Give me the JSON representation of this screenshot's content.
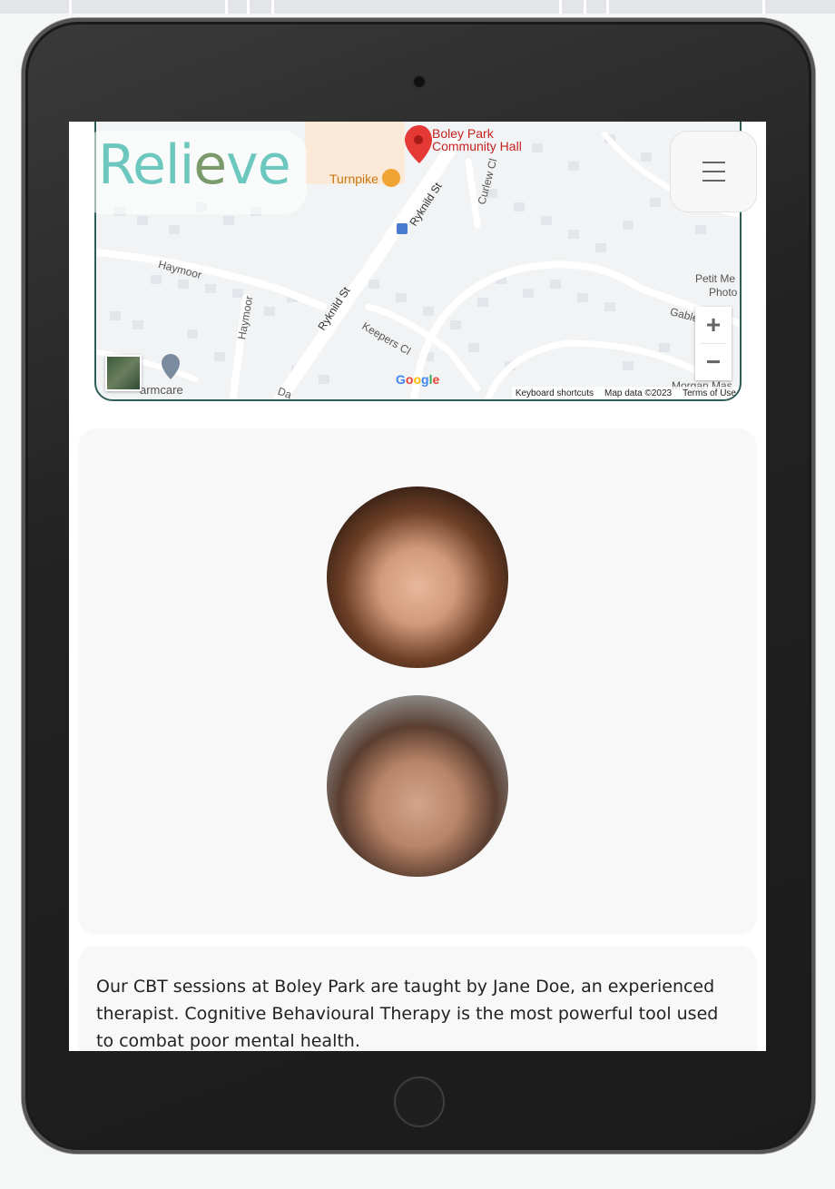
{
  "brand": {
    "logo_part1": "Rel",
    "logo_part2": "i",
    "logo_part3": "e",
    "logo_part4": "v",
    "logo_part5": "e"
  },
  "colors": {
    "accent": "#6cc7be",
    "accent_alt": "#7b9a6b",
    "map_border": "#2f5d57"
  },
  "map": {
    "pin_label_line1": "Boley Park",
    "pin_label_line2": "Community Hall",
    "pub_label": "Turnpike",
    "streets": [
      "Ryknild St",
      "Ryknild St",
      "Curlew Cl",
      "Haymoor",
      "Haymoor",
      "Keepers Cl",
      "Gable",
      "Da"
    ],
    "places": [
      "Petit Me",
      "Photo",
      "Morgan Mas",
      "armcare"
    ],
    "footer": {
      "shortcuts": "Keyboard shortcuts",
      "mapdata": "Map data ©2023",
      "terms": "Terms of Use"
    },
    "google_logo": "Google",
    "zoom_in": "+",
    "zoom_out": "−"
  },
  "menu": {
    "icon": "hamburger-menu-icon"
  },
  "therapists": [
    {
      "photo": "female-therapist-portrait"
    },
    {
      "photo": "male-therapist-portrait"
    }
  ],
  "description": "Our CBT sessions at Boley Park are taught by Jane Doe, an experienced therapist. Cognitive Behavioural Therapy is the most powerful tool used to combat poor mental health."
}
